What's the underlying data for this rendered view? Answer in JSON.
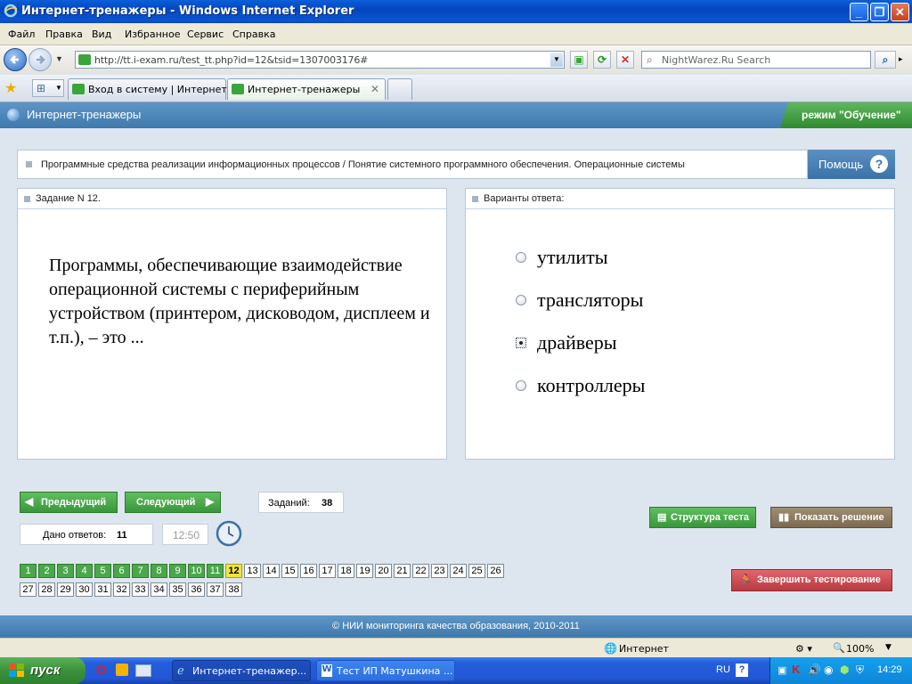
{
  "window": {
    "title": "Интернет-тренажеры - Windows Internet Explorer"
  },
  "menu": [
    "Файл",
    "Правка",
    "Вид",
    "Избранное",
    "Сервис",
    "Справка"
  ],
  "address": {
    "url": "http://tt.i-exam.ru/test_tt.php?id=12&tsid=1307003176#",
    "search_placeholder": "NightWarez.Ru Search"
  },
  "tabs": [
    {
      "label": "Вход в систему | Интернет-..."
    },
    {
      "label": "Интернет-тренажеры"
    }
  ],
  "app": {
    "title": "Интернет-тренажеры",
    "mode": "режим \"Обучение\""
  },
  "topic": {
    "text": "Программные средства реализации информационных процессов / Понятие системного программного обеспечения. Операционные системы",
    "help_label": "Помощь",
    "help_glyph": "?"
  },
  "task": {
    "header": "Задание N 12.",
    "question": "Программы, обеспечивающие взаимодействие операционной системы с периферийным устройством (принтером, дисководом, дисплеем и т.п.), – это ..."
  },
  "answers": {
    "header": "Варианты ответа:",
    "options": [
      {
        "label": "утилиты",
        "selected": false
      },
      {
        "label": "трансляторы",
        "selected": false
      },
      {
        "label": "драйверы",
        "selected": true
      },
      {
        "label": "контроллеры",
        "selected": false
      }
    ]
  },
  "controls": {
    "prev_label": "Предыдущий",
    "next_label": "Следующий",
    "tasks_label": "Заданий:",
    "tasks_count": "38",
    "answers_label": "Дано ответов:",
    "answers_count": "11",
    "timer": "12:50",
    "structure_label": "Структура теста",
    "solution_label": "Показать решение",
    "finish_label": "Завершить тестирование"
  },
  "questions": {
    "numbers": [
      "1",
      "2",
      "3",
      "4",
      "5",
      "6",
      "7",
      "8",
      "9",
      "10",
      "11",
      "12",
      "13",
      "14",
      "15",
      "16",
      "17",
      "18",
      "19",
      "20",
      "21",
      "22",
      "23",
      "24",
      "25",
      "26",
      "27",
      "28",
      "29",
      "30",
      "31",
      "32",
      "33",
      "34",
      "35",
      "36",
      "37",
      "38"
    ],
    "answered": 11,
    "current": "12"
  },
  "footer": {
    "text": "© НИИ мониторинга качества образования, 2010-2011"
  },
  "status": {
    "zone": "Интернет",
    "zoom": "100%"
  },
  "taskbar": {
    "start": "пуск",
    "items": [
      {
        "label": "Интернет-тренажер..."
      },
      {
        "label": "Тест ИП Матушкина ..."
      }
    ],
    "lang": "RU",
    "clock": "14:29"
  },
  "colors": {
    "accent_blue": "#3f79ad",
    "done_green": "#4aa84a",
    "current_yellow": "#f1e53a",
    "finish_red": "#c8434a"
  }
}
